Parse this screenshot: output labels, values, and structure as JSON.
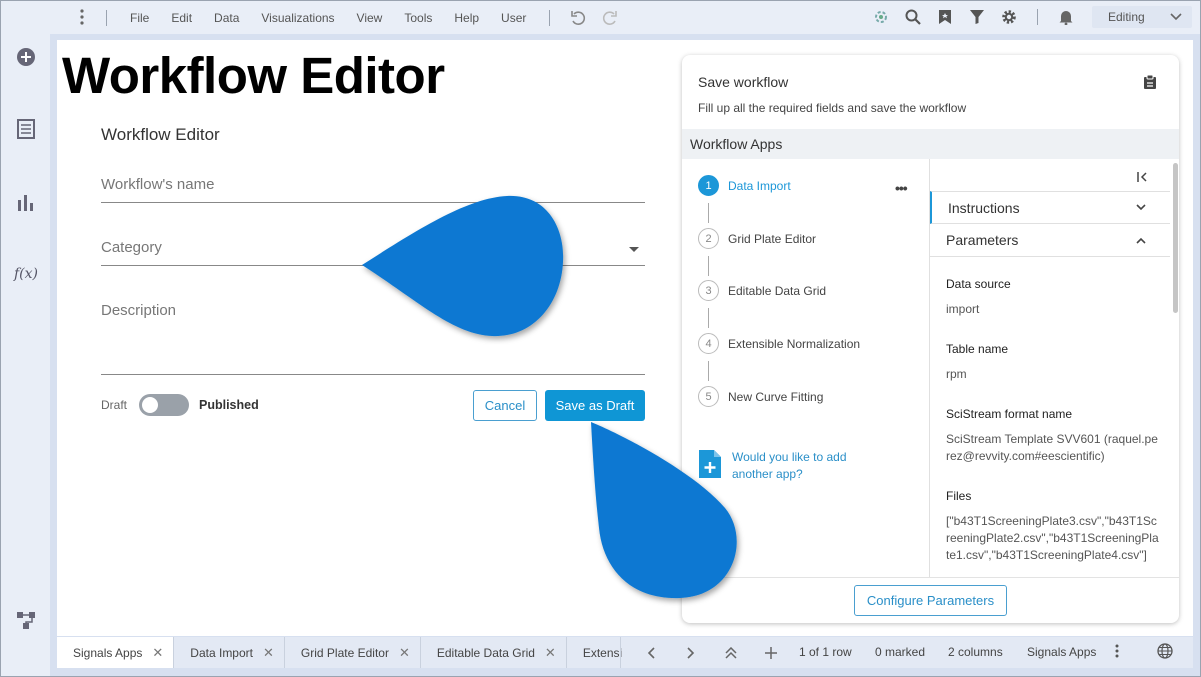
{
  "menu": {
    "items": [
      "File",
      "Edit",
      "Data",
      "Visualizations",
      "View",
      "Tools",
      "Help",
      "User"
    ],
    "mode": "Editing"
  },
  "sidebar": {
    "icons": [
      "add-icon",
      "data-table-icon",
      "bar-chart-icon",
      "fx-icon",
      "workflow-icon"
    ],
    "fx_label": "f(x)"
  },
  "page": {
    "big_title": "Workflow Editor"
  },
  "form": {
    "title": "Workflow Editor",
    "name_placeholder": "Workflow's name",
    "category_placeholder": "Category",
    "description_placeholder": "Description",
    "draft_label": "Draft",
    "published_label": "Published",
    "publish_state": "Draft",
    "cancel_label": "Cancel",
    "save_draft_label": "Save as Draft"
  },
  "panel": {
    "title": "Save workflow",
    "subtitle": "Fill up all the required fields and save the workflow",
    "apps_header": "Workflow Apps",
    "steps": [
      {
        "num": "1",
        "label": "Data Import",
        "active": true
      },
      {
        "num": "2",
        "label": "Grid Plate Editor",
        "active": false
      },
      {
        "num": "3",
        "label": "Editable Data Grid",
        "active": false
      },
      {
        "num": "4",
        "label": "Extensible Normalization",
        "active": false
      },
      {
        "num": "5",
        "label": "New Curve Fitting",
        "active": false
      }
    ],
    "more_label": "•••",
    "add_app_text": "Would you like to add another app?",
    "instructions_label": "Instructions",
    "parameters_label": "Parameters",
    "params": [
      {
        "label": "Data source",
        "value": "import"
      },
      {
        "label": "Table name",
        "value": "rpm"
      },
      {
        "label": "SciStream format name",
        "value": "SciStream Template SVV601 (raquel.perez@revvity.com#eescientific)"
      },
      {
        "label": "Files",
        "value": "[\"b43T1ScreeningPlate3.csv\",\"b43T1ScreeningPlate2.csv\",\"b43T1ScreeningPlate1.csv\",\"b43T1ScreeningPlate4.csv\"]"
      }
    ],
    "configure_label": "Configure Parameters"
  },
  "bottom": {
    "tabs": [
      "Signals Apps",
      "Data Import",
      "Grid Plate Editor",
      "Editable Data Grid",
      "Extensi"
    ],
    "row_info": "1 of 1 row",
    "marked_info": "0 marked",
    "columns_info": "2 columns",
    "source_label": "Signals Apps"
  },
  "colors": {
    "accent": "#0f96d5",
    "drop": "#0a78d2"
  }
}
